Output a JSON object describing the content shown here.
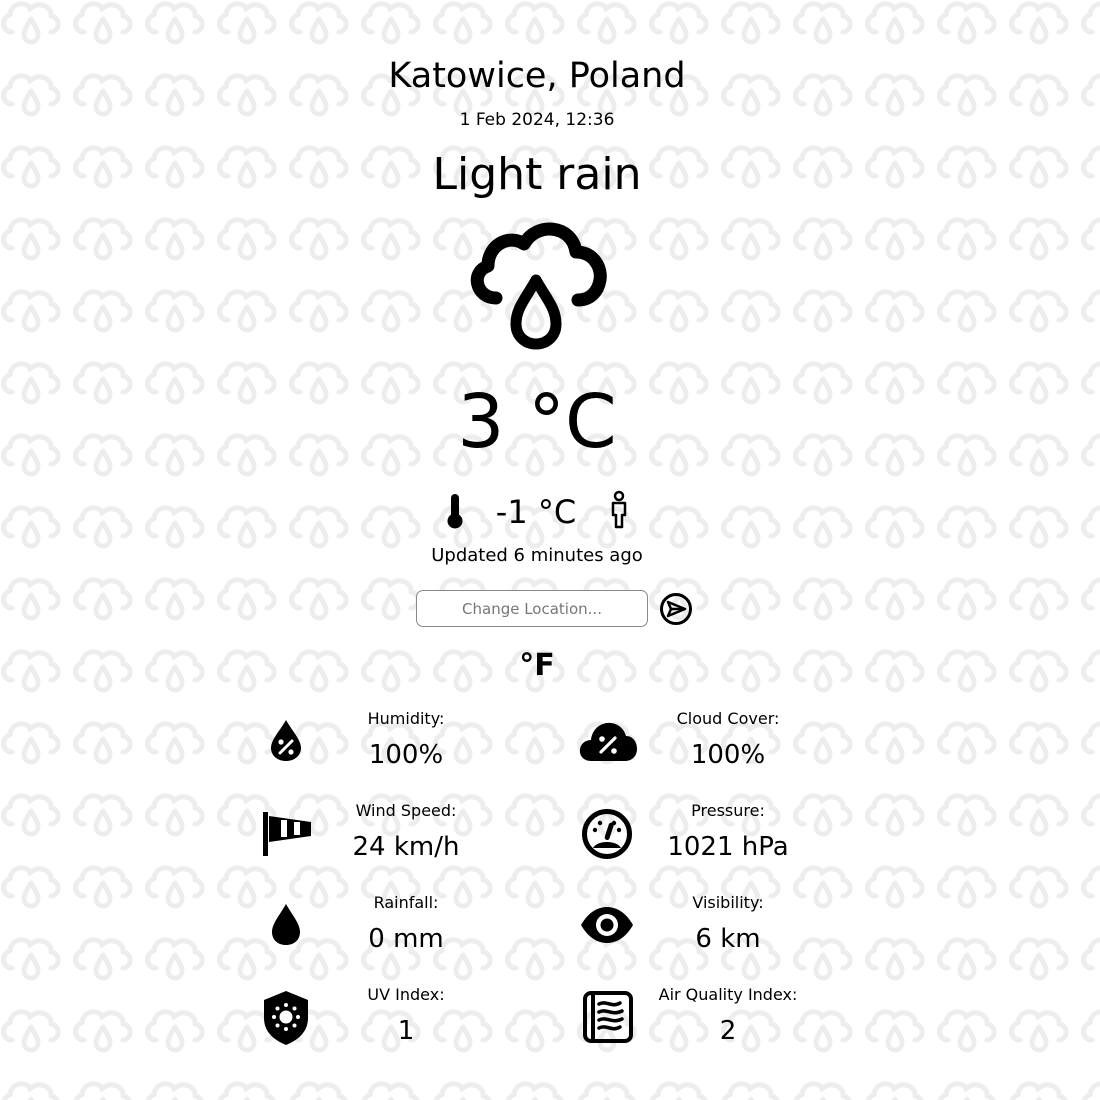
{
  "location": "Katowice, Poland",
  "datetime": "1 Feb 2024, 12:36",
  "condition": "Light rain",
  "temperature": "3 °C",
  "feels_like": "-1 °C",
  "updated": "Updated 6 minutes ago",
  "search": {
    "placeholder": "Change Location..."
  },
  "unit_toggle": "°F",
  "stats": {
    "humidity": {
      "label": "Humidity:",
      "value": "100%"
    },
    "cloud_cover": {
      "label": "Cloud Cover:",
      "value": "100%"
    },
    "wind_speed": {
      "label": "Wind Speed:",
      "value": "24 km/h"
    },
    "pressure": {
      "label": "Pressure:",
      "value": "1021 hPa"
    },
    "rainfall": {
      "label": "Rainfall:",
      "value": "0 mm"
    },
    "visibility": {
      "label": "Visibility:",
      "value": "6 km"
    },
    "uv_index": {
      "label": "UV Index:",
      "value": "1"
    },
    "air_quality": {
      "label": "Air Quality Index:",
      "value": "2"
    }
  },
  "icons": {
    "main": "cloud-rain-drop-icon",
    "feels_like": "thermometer-icon",
    "feels_like_person": "person-icon",
    "submit": "send-arrow-icon",
    "humidity": "humidity-drop-icon",
    "cloud_cover": "cloud-percent-icon",
    "wind_speed": "windsock-icon",
    "pressure": "gauge-icon",
    "rainfall": "raindrop-icon",
    "visibility": "eye-icon",
    "uv_index": "shield-sun-icon",
    "air_quality": "air-quality-icon"
  },
  "colors": {
    "text": "#000000",
    "background": "#ffffff",
    "pattern": "#ececec"
  }
}
